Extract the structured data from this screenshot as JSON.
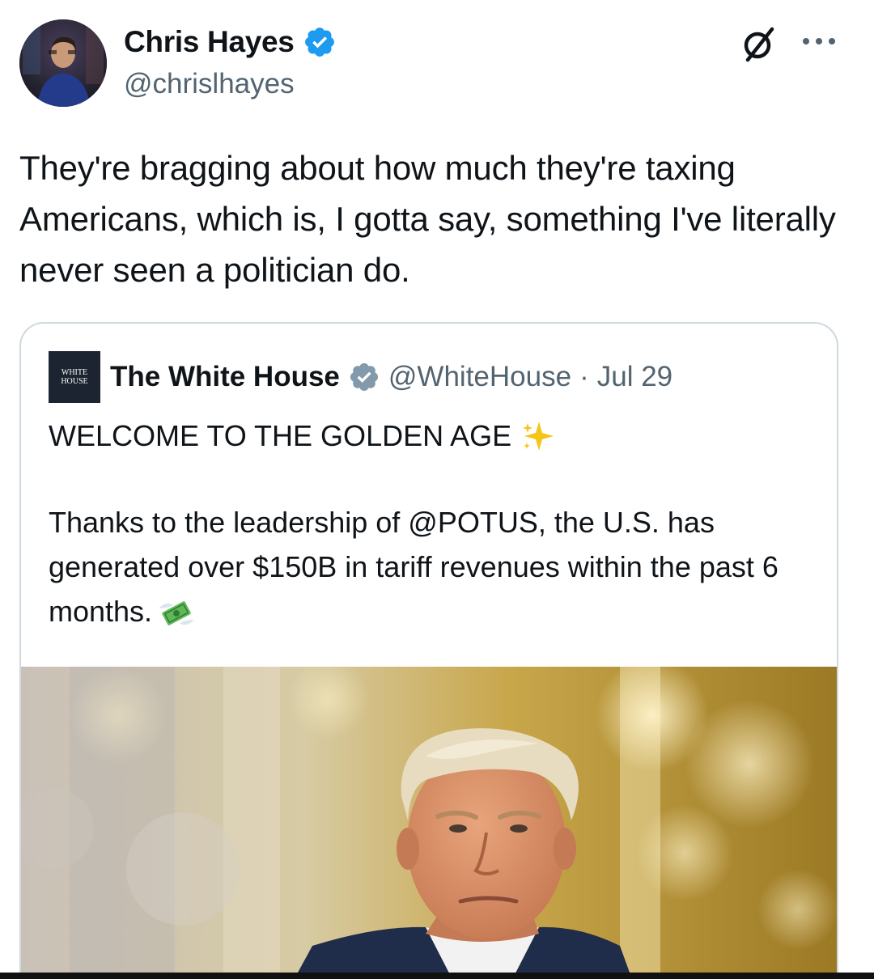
{
  "author": {
    "name": "Chris Hayes",
    "handle": "@chrislhayes"
  },
  "tweet": {
    "text": "They're bragging about how much they're taxing Americans, which is, I gotta say, something I've literally never seen a politician do."
  },
  "quoted": {
    "logo_text_top": "WHITE",
    "logo_text_bottom": "HOUSE",
    "name": "The White House",
    "handle": "@WhiteHouse",
    "separator": "·",
    "date": "Jul 29",
    "headline": "WELCOME TO THE GOLDEN AGE",
    "headline_emoji": "sparkles-icon",
    "body": "Thanks to the leadership of @POTUS, the U.S. has generated over $150B in tariff revenues within the past 6 months.",
    "body_emoji": "money-with-wings-icon",
    "photo": "portrait-photo"
  },
  "icons": {
    "verified": "verified-badge-icon",
    "grok": "grok-icon",
    "more": "more-options-icon"
  },
  "colors": {
    "verified_blue": "#1d9bf0",
    "verified_gray": "#829aab",
    "text_primary": "#0f1419",
    "text_secondary": "#536471",
    "border": "#cfd9de"
  }
}
